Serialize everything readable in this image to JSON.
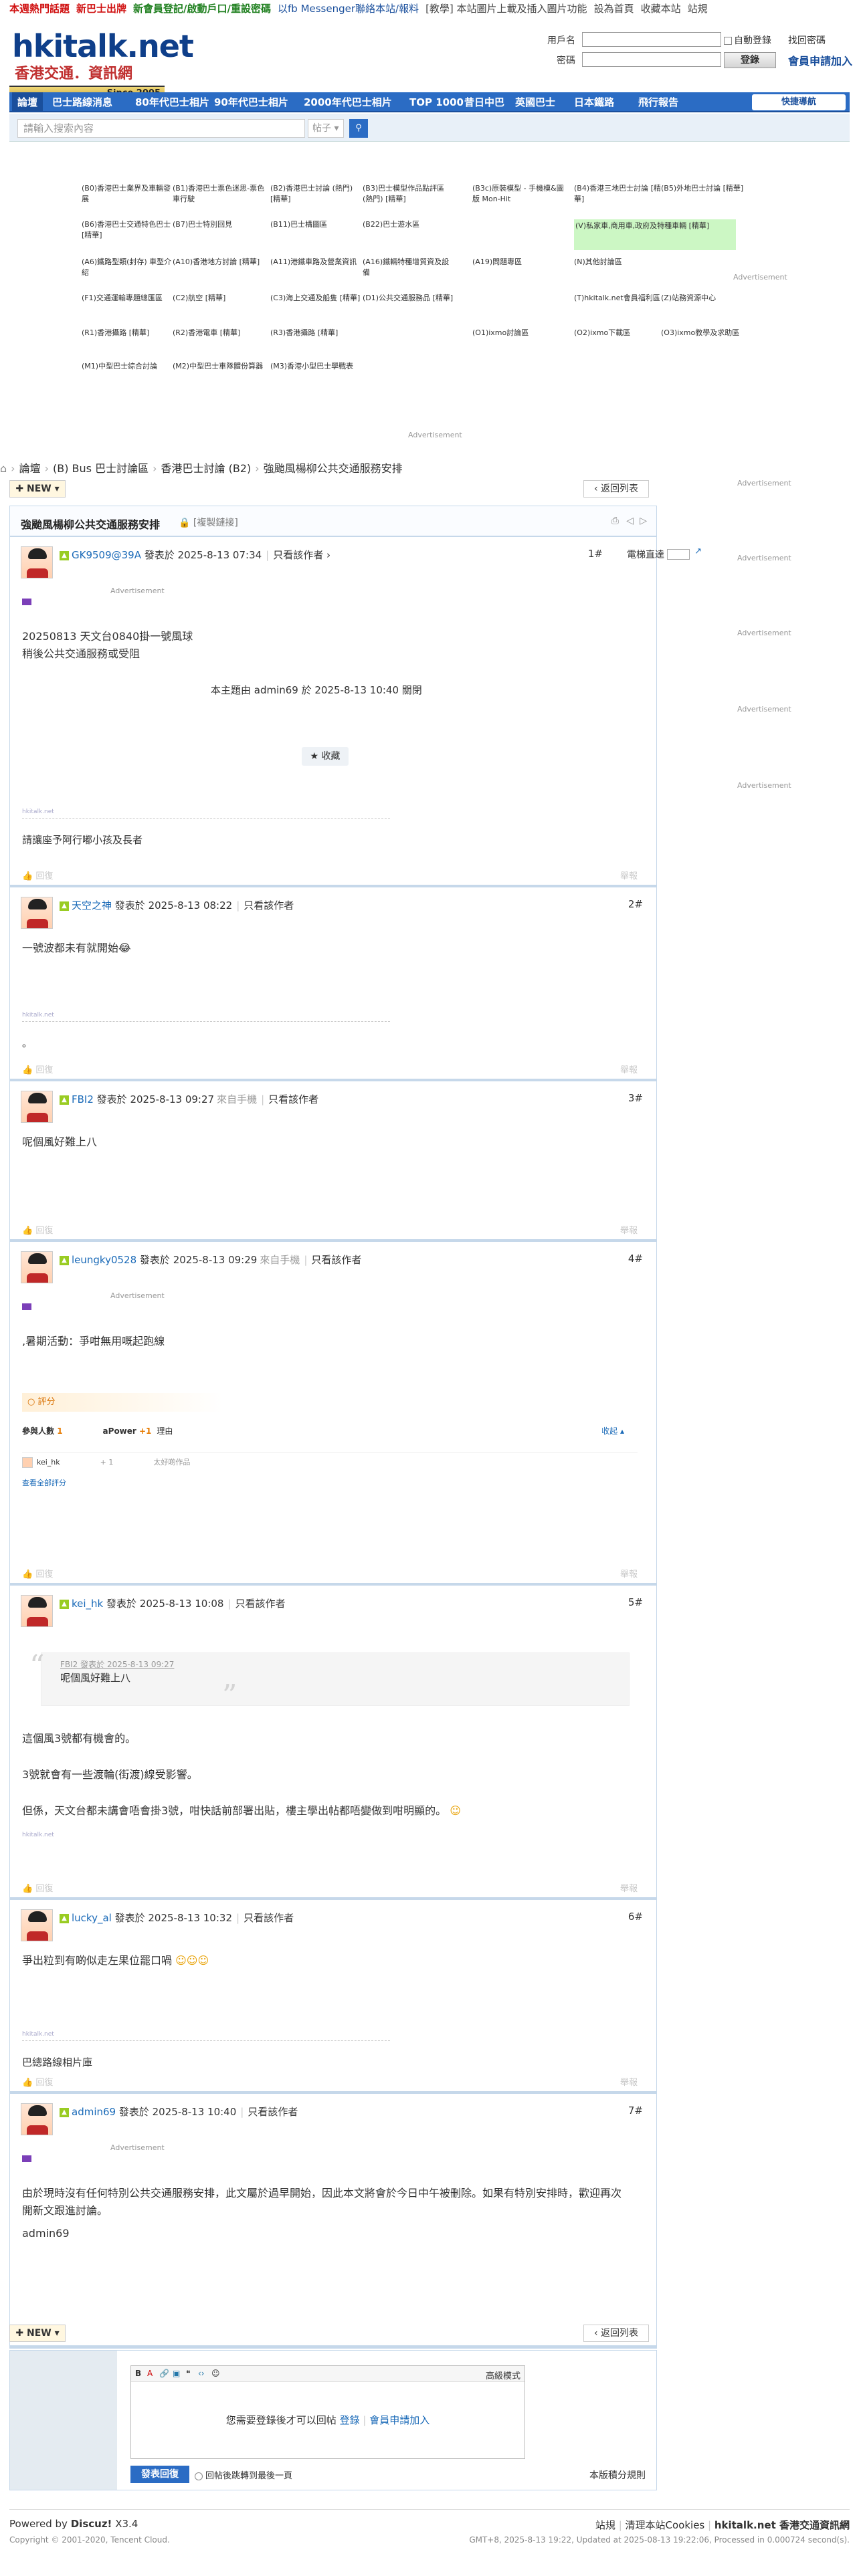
{
  "topbar": [
    {
      "text": "本週熱門話題",
      "color": "#d01010"
    },
    {
      "text": "新巴士出牌",
      "color": "#d01010"
    },
    {
      "text": "新會員登記/啟動戶口/重設密碼",
      "color": "#208020"
    },
    {
      "text": "以fb Messenger聯絡本站/報料",
      "color": "#1a4f9c"
    },
    {
      "text": "[教學] 本站圖片上載及插入圖片功能",
      "color": "#444"
    },
    {
      "text": "設為首頁",
      "color": "#444"
    },
    {
      "text": "收藏本站",
      "color": "#444"
    },
    {
      "text": "站規",
      "color": "#444"
    }
  ],
  "logo": {
    "main": "hkitalk.net",
    "sub": "香港交通．資訊網",
    "since": "Since 2005"
  },
  "login": {
    "user_label": "用戶名",
    "pass_label": "密碼",
    "auto_login": "自動登錄",
    "forgot": "找回密碼",
    "login_btn": "登錄",
    "register": "會員申請加入"
  },
  "nav": {
    "items": [
      "論壇",
      "巴士路線消息",
      "80年代巴士相片",
      "90年代巴士相片",
      "2000年代巴士相片",
      "TOP 1000",
      "昔日中巴",
      "英國巴士",
      "日本鐵路",
      "飛行報告"
    ],
    "quick": "快捷導航"
  },
  "search": {
    "placeholder": "請輸入搜索內容",
    "type": "帖子"
  },
  "forums": [
    [
      "(B0)香港巴士業界及車輛發展",
      "(B1)香港巴士票色迷思-票色車行駛",
      "(B2)香港巴士討論 (熱門) [精華]",
      "(B3)巴士模型作品點評區 (熱門) [精華]",
      "(B3c)原裝模型 - 手機模&圖版 Mon-Hit",
      "(B4)香港三地巴士討論 [精華]",
      "(B5)外地巴士討論 [精華]"
    ],
    [
      "(B6)香港巴士交通特色巴士 [精華]",
      "(B7)巴士特別回見",
      "(B11)巴士構圖區",
      "(B22)巴士遊水區",
      "",
      "(V)私家車,商用車,政府及特種車輛 [精華]",
      ""
    ],
    [
      "(A6)鐵路型類(封存) 車型介紹",
      "(A10)香港地方討論 [精華]",
      "(A11)港鐵車路及營業資訊",
      "(A16)鐵輛特種增貿資及設備",
      "(A19)問題專區",
      "(N)其他討論區",
      ""
    ],
    [
      "(F1)交通運輸專題總匯區",
      "(C2)航空 [精華]",
      "(C3)海上交通及船隻 [精華]",
      "(D1)公共交通服務品 [精華]",
      "",
      "(T)hkitalk.net會員福利區",
      "(Z)站務資源中心"
    ],
    [
      "(R1)香港攝路 [精華]",
      "(R2)香港電車 [精華]",
      "(R3)香港攝路 [精華]",
      "",
      "(O1)ixmo討論區",
      "(O2)ixmo下載區",
      "(O3)ixmo教學及求助區"
    ],
    [
      "(M1)中型巴士綜合討論",
      "(M2)中型巴士車隊體份算器",
      "(M3)香港小型巴士學戰表",
      "",
      "",
      "",
      ""
    ]
  ],
  "advert_label": "Advertisement",
  "breadcrumb": [
    "論壇",
    "(B) Bus 巴士討論區",
    "香港巴士討論 (B2)",
    "強颱風楊柳公共交通服務安排"
  ],
  "buttons": {
    "new": "NEW",
    "back": "返回列表"
  },
  "thread": {
    "title": "強颱風楊柳公共交通服務安排",
    "copy_link": "[複製鏈接]",
    "view_label": "電梯直達"
  },
  "posts": [
    {
      "author": "GK9509@39A",
      "posted": "發表於 2025-8-13 07:34",
      "only_author": "只看該作者",
      "floor": "1#",
      "device": "",
      "lines": [
        "20250813 天文台0840掛一號風球",
        "稍後公共交通服務或受阻"
      ],
      "edit_note": "本主題由 admin69 於 2025-8-13 10:40 關閉",
      "fav": "收藏",
      "sig": "請讓座予阿行嘟小孩及長者",
      "foot_left": "回復",
      "foot_right": "舉報"
    },
    {
      "author": "天空之神",
      "posted": "發表於 2025-8-13 08:22",
      "only_author": "只看該作者",
      "floor": "2#",
      "device": "",
      "lines": [
        "一號波都未有就開始😂"
      ],
      "sig": "。",
      "foot_left": "回復",
      "foot_right": "舉報"
    },
    {
      "author": "FBI2",
      "posted": "發表於 2025-8-13 09:27",
      "only_author": "只看該作者",
      "floor": "3#",
      "device": "來自手機",
      "lines": [
        "呢個風好難上八"
      ],
      "foot_left": "回復",
      "foot_right": "舉報"
    },
    {
      "author": "leungky0528",
      "posted": "發表於 2025-8-13 09:29",
      "only_author": "只看該作者",
      "floor": "4#",
      "device": "來自手機",
      "lines": [
        ",暑期活動：爭咁無用嘅起跑線"
      ],
      "rate": {
        "title": "評分",
        "hdr_people": "參與人數",
        "hdr_count": "1",
        "hdr_apower": "aPower",
        "hdr_plus": "+1",
        "hdr_reason": "理由",
        "collapse": "收起",
        "user": "kei_hk",
        "val": "+ 1",
        "reason": "太好啲作品",
        "all": "查看全部評分"
      },
      "foot_left": "回復",
      "foot_right": "舉報"
    },
    {
      "author": "kei_hk",
      "posted": "發表於 2025-8-13 10:08",
      "only_author": "只看該作者",
      "floor": "5#",
      "device": "",
      "quote_by": "FBI2 發表於 2025-8-13 09:27",
      "quote_text": "呢個風好難上八",
      "lines": [
        "這個風3號都有機會的。",
        "3號就會有一些渡輪(街渡)線受影響。",
        "但係，天文台都未講會唔會掛3號，咁快話前部署出貼，樓主學出帖都唔變做到咁明顯的。"
      ],
      "foot_left": "回復",
      "foot_right": "舉報"
    },
    {
      "author": "lucky_al",
      "posted": "發表於 2025-8-13 10:32",
      "only_author": "只看該作者",
      "floor": "6#",
      "device": "",
      "lines": [
        "爭出粒到有啲似走左果位罷口喎"
      ],
      "sig": "巴總路線相片庫",
      "foot_left": "回復",
      "foot_right": "舉報"
    },
    {
      "author": "admin69",
      "posted": "發表於 2025-8-13 10:40",
      "only_author": "只看該作者",
      "floor": "7#",
      "device": "",
      "lines": [
        "由於現時沒有任何特別公共交通服務安排，此文屬於過早開始，因此本文將會於今日中午被刪除。如果有特別安排時，歡迎再次開新文跟進討論。",
        "admin69"
      ],
      "foot_left": "回復",
      "foot_right": "舉報"
    }
  ],
  "reply": {
    "advanced": "高級模式",
    "need_login": "您需要登錄後才可以回帖",
    "login": "登錄",
    "register": "會員申請加入",
    "submit": "發表回復",
    "return_last": "回帖後跳轉到最後一頁",
    "rules": "本版積分規則"
  },
  "footer": {
    "powered": "Powered by",
    "discuz": "Discuz!",
    "ver": "X3.4",
    "copy": "Copyright © 2001-2020, Tencent Cloud.",
    "links": [
      "站規",
      "清理本站Cookies",
      "hkitalk.net 香港交通資訊網"
    ],
    "gmt": "GMT+8, 2025-8-13 19:22, Updated at 2025-08-13 19:22:06, Processed in 0.000724 second(s)."
  }
}
